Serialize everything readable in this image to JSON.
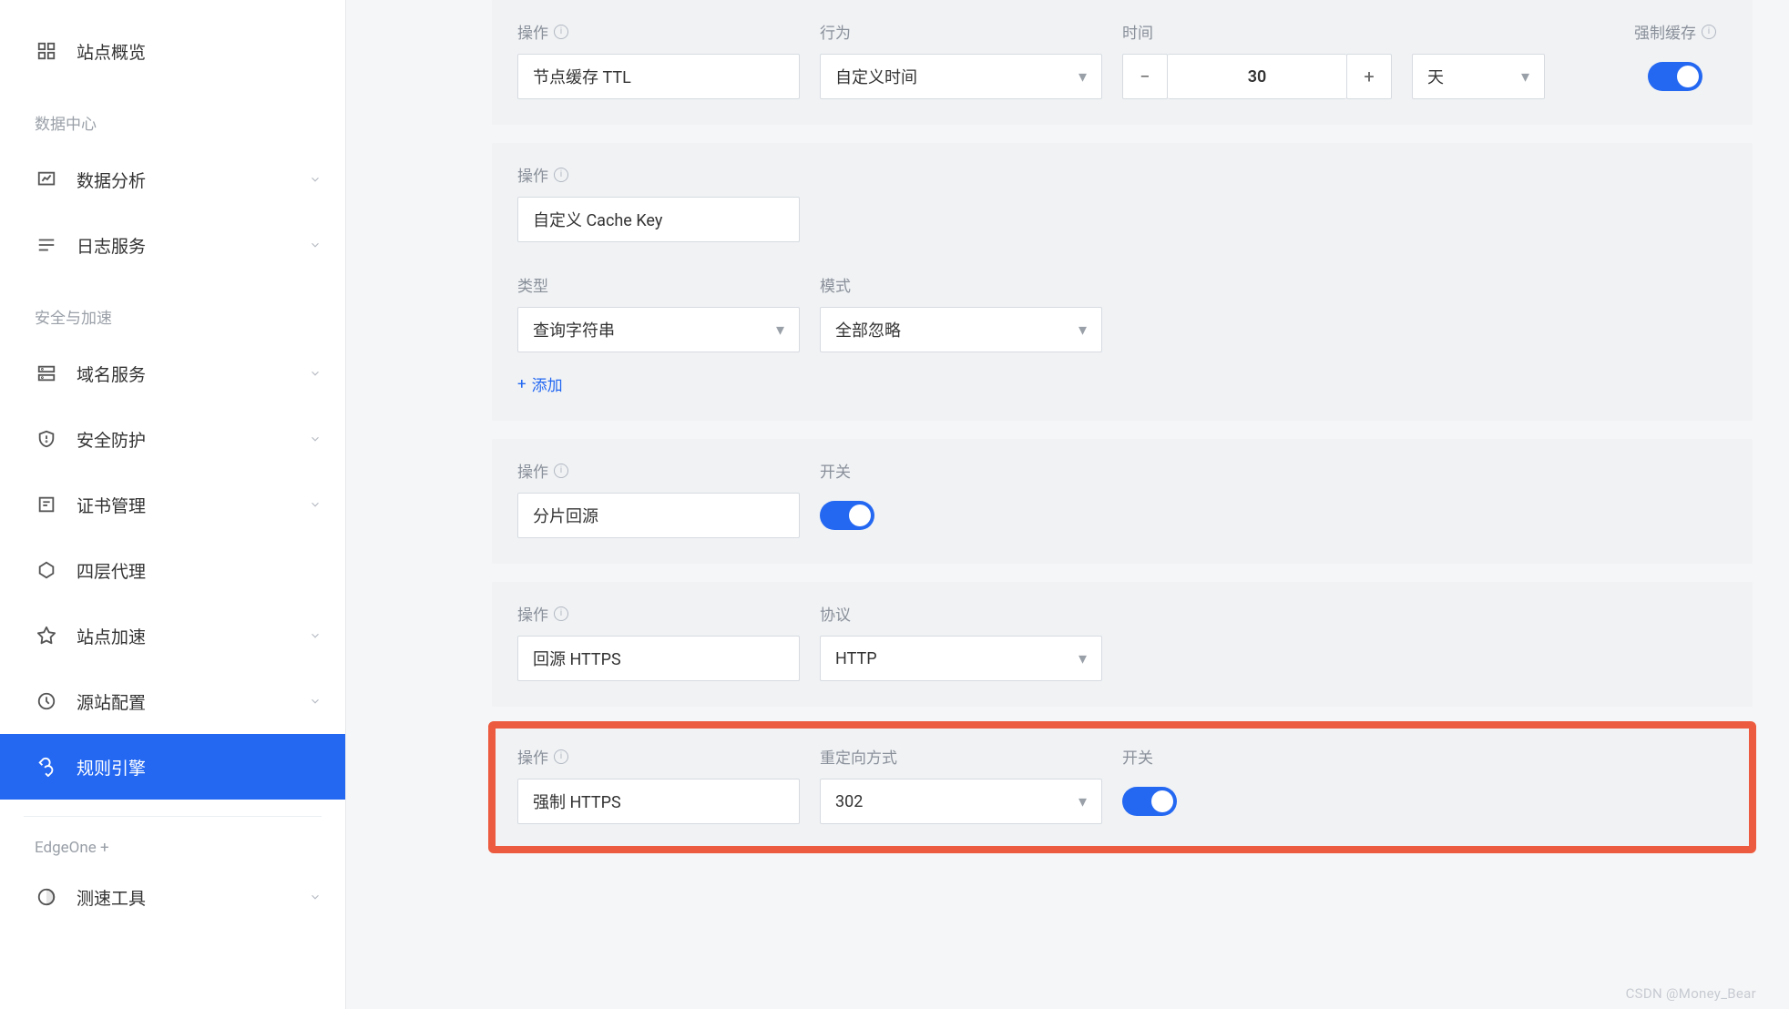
{
  "sidebar": {
    "overview": "站点概览",
    "group_data": "数据中心",
    "items_data": [
      {
        "label": "数据分析"
      },
      {
        "label": "日志服务"
      }
    ],
    "group_sec": "安全与加速",
    "items_sec": [
      {
        "label": "域名服务"
      },
      {
        "label": "安全防护"
      },
      {
        "label": "证书管理"
      },
      {
        "label": "四层代理"
      },
      {
        "label": "站点加速"
      },
      {
        "label": "源站配置"
      },
      {
        "label": "规则引擎"
      }
    ],
    "edgeone": "EdgeOne +",
    "speed": "测速工具"
  },
  "labels": {
    "action": "操作",
    "behavior": "行为",
    "time": "时间",
    "force_cache": "强制缓存",
    "type": "类型",
    "mode": "模式",
    "add": "添加",
    "switch": "开关",
    "protocol": "协议",
    "redirect_mode": "重定向方式"
  },
  "card1": {
    "action": "节点缓存 TTL",
    "behavior": "自定义时间",
    "time_value": "30",
    "unit": "天"
  },
  "card2": {
    "action": "自定义 Cache Key",
    "type": "查询字符串",
    "mode": "全部忽略"
  },
  "card3": {
    "action": "分片回源"
  },
  "card4": {
    "action": "回源 HTTPS",
    "protocol": "HTTP"
  },
  "card5": {
    "action": "强制 HTTPS",
    "redirect": "302"
  },
  "watermark": "CSDN @Money_Bear"
}
